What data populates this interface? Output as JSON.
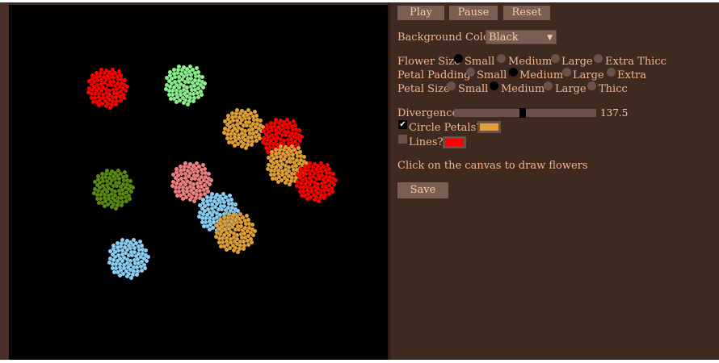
{
  "controls": {
    "play_label": "Play",
    "pause_label": "Pause",
    "reset_label": "Reset"
  },
  "background_color": {
    "label": "Background Color",
    "selected": "Black"
  },
  "flower_size": {
    "label": "Flower Size",
    "options": [
      "Small",
      "Medium",
      "Large",
      "Extra Thicc"
    ],
    "selected": "Small"
  },
  "petal_padding": {
    "label": "Petal Padding",
    "options": [
      "Small",
      "Medium",
      "Large",
      "Extra"
    ],
    "selected": "Medium"
  },
  "petal_size": {
    "label": "Petal Size",
    "options": [
      "Small",
      "Medium",
      "Large",
      "Thicc"
    ],
    "selected": "Medium"
  },
  "divergence": {
    "label": "Divergence",
    "value": "137.5",
    "fraction": 0.48
  },
  "circle_petals": {
    "label": "Circle Petals?",
    "checked": true,
    "color": "#e3a035"
  },
  "lines": {
    "label": "Lines?",
    "checked": false,
    "color": "#ff0000"
  },
  "instructions": "Click on the canvas to draw flowers",
  "save_label": "Save",
  "canvas": {
    "background": "#000000",
    "flowers": [
      {
        "color": "#ff0000"
      },
      {
        "color": "#8cf08c"
      },
      {
        "color": "#e3a035"
      },
      {
        "color": "#ff0000"
      },
      {
        "color": "#e3a035"
      },
      {
        "color": "#ff0000"
      },
      {
        "color": "#5a8a12"
      },
      {
        "color": "#f08080"
      },
      {
        "color": "#8ad0f5"
      },
      {
        "color": "#e3a035"
      },
      {
        "color": "#8ad0f5"
      }
    ]
  }
}
